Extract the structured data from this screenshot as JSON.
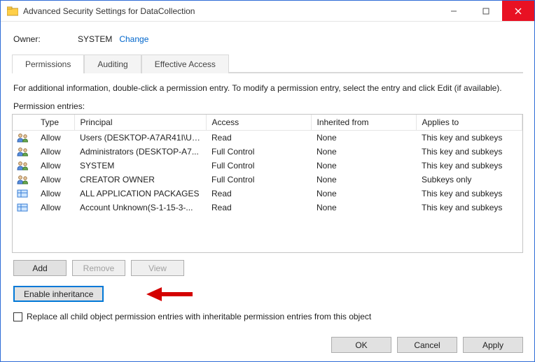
{
  "window": {
    "title": "Advanced Security Settings for DataCollection"
  },
  "owner": {
    "label": "Owner:",
    "value": "SYSTEM",
    "change": "Change"
  },
  "tabs": {
    "permissions": "Permissions",
    "auditing": "Auditing",
    "effective": "Effective Access"
  },
  "hint": "For additional information, double-click a permission entry. To modify a permission entry, select the entry and click Edit (if available).",
  "entries_label": "Permission entries:",
  "columns": {
    "type": "Type",
    "principal": "Principal",
    "access": "Access",
    "inherited": "Inherited from",
    "applies": "Applies to"
  },
  "rows": [
    {
      "icon": "users",
      "type": "Allow",
      "principal": "Users (DESKTOP-A7AR41I\\Us...",
      "access": "Read",
      "inherited": "None",
      "applies": "This key and subkeys"
    },
    {
      "icon": "users",
      "type": "Allow",
      "principal": "Administrators (DESKTOP-A7...",
      "access": "Full Control",
      "inherited": "None",
      "applies": "This key and subkeys"
    },
    {
      "icon": "users",
      "type": "Allow",
      "principal": "SYSTEM",
      "access": "Full Control",
      "inherited": "None",
      "applies": "This key and subkeys"
    },
    {
      "icon": "users",
      "type": "Allow",
      "principal": "CREATOR OWNER",
      "access": "Full Control",
      "inherited": "None",
      "applies": "Subkeys only"
    },
    {
      "icon": "package",
      "type": "Allow",
      "principal": "ALL APPLICATION PACKAGES",
      "access": "Read",
      "inherited": "None",
      "applies": "This key and subkeys"
    },
    {
      "icon": "package",
      "type": "Allow",
      "principal": "Account Unknown(S-1-15-3-...",
      "access": "Read",
      "inherited": "None",
      "applies": "This key and subkeys"
    }
  ],
  "buttons": {
    "add": "Add",
    "remove": "Remove",
    "view": "View",
    "enable_inheritance": "Enable inheritance",
    "ok": "OK",
    "cancel": "Cancel",
    "apply": "Apply"
  },
  "replace_check": "Replace all child object permission entries with inheritable permission entries from this object"
}
